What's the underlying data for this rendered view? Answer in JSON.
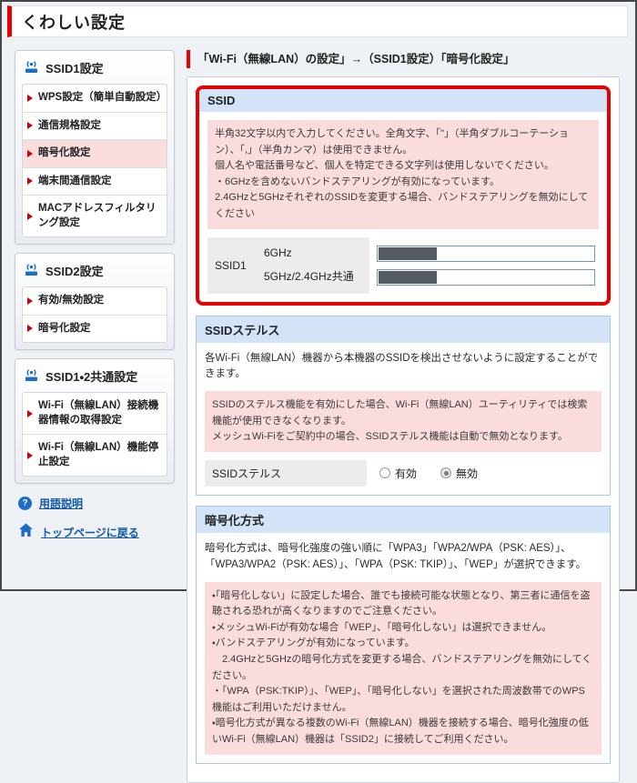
{
  "page": {
    "title": "くわしい設定"
  },
  "colors": {
    "accent_red": "#e60000",
    "section_header_blue": "#d3e4f8",
    "notice_pink": "#fadcdc",
    "link_blue": "#1257a4",
    "icon_blue": "#1b6ec8",
    "active_item_pink": "#fadddd",
    "masked_value_gray": "#565b61"
  },
  "icons": {
    "question_glyph": "?"
  },
  "sidebar": {
    "sections": [
      {
        "title": "SSID1設定",
        "icon": "router-signal-icon",
        "items": [
          {
            "label": "WPS設定（簡単自動設定）",
            "active": false
          },
          {
            "label": "通信規格設定",
            "active": false
          },
          {
            "label": "暗号化設定",
            "active": true
          },
          {
            "label": "端末間通信設定",
            "active": false
          },
          {
            "label": "MACアドレスフィルタリング設定",
            "active": false
          }
        ]
      },
      {
        "title": "SSID2設定",
        "icon": "router-signal-icon",
        "items": [
          {
            "label": "有効/無効設定",
            "active": false
          },
          {
            "label": "暗号化設定",
            "active": false
          }
        ]
      },
      {
        "title": "SSID1・2共通設定",
        "icon": "router-signal-icon",
        "items": [
          {
            "label": "Wi-Fi（無線LAN）接続機器情報の取得設定",
            "active": false
          },
          {
            "label": "Wi-Fi（無線LAN）機能停止設定",
            "active": false
          }
        ]
      }
    ],
    "links": [
      {
        "label": "用語説明",
        "icon": "question-icon"
      },
      {
        "label": "トップページに戻る",
        "icon": "home-icon"
      }
    ]
  },
  "main": {
    "breadcrumb": "「Wi-Fi（無線LAN）の設定」→（SSID1設定）「暗号化設定」",
    "ssid_section": {
      "title": "SSID",
      "highlighted": true,
      "notice_lines": [
        "半角32文字以内で入力してください。全角文字、「\"」（半角ダブルコーテーション）、「,」（半角カンマ）は使用できません。",
        "個人名や電話番号など、個人を特定できる文字列は使用しないでください。",
        "・6GHzを含めないバンドステアリングが有効になっています。",
        "2.4GHzと5GHzそれぞれのSSIDを変更する場合、バンドステアリングを無効にしてください"
      ],
      "row_label": "SSID1",
      "fields": [
        {
          "label": "6GHz",
          "value": "",
          "value_masked": true
        },
        {
          "label": "5GHz/2.4GHz共通",
          "value": "",
          "value_masked": true
        }
      ]
    },
    "stealth_section": {
      "title": "SSIDステルス",
      "description": "各Wi-Fi（無線LAN）機器から本機器のSSIDを検出させないように設定することができます。",
      "notice_lines": [
        "SSIDのステルス機能を有効にした場合、Wi-Fi（無線LAN）ユーティリティでは検索機能が使用できなくなります。",
        "メッシュWi-Fiをご契約中の場合、SSIDステルス機能は自動で無効となります。"
      ],
      "field_label": "SSIDステルス",
      "radio_options": [
        {
          "label": "有効",
          "selected": false
        },
        {
          "label": "無効",
          "selected": true
        }
      ]
    },
    "encryption_section": {
      "title": "暗号化方式",
      "description": "暗号化方式は、暗号化強度の強い順に「WPA3」「WPA2/WPA（PSK: AES）」、「WPA3/WPA2（PSK: AES）」、「WPA（PSK: TKIP）」、「WEP」が選択できます。",
      "notice_lines": [
        "・「暗号化しない」に設定した場合、誰でも接続可能な状態となり、第三者に通信を盗聴される恐れが高くなりますのでご注意ください。",
        "・メッシュWi-Fiが有効な場合「WEP」、「暗号化しない」は選択できません。",
        "・バンドステアリングが有効になっています。",
        "　2.4GHzと5GHzの暗号化方式を変更する場合、バンドステアリングを無効にしてください。",
        "・「WPA（PSK:TKIP）」、「WEP」、「暗号化しない」を選択された周波数帯でのWPS機能はご利用いただけません。",
        "・暗号化方式が異なる複数のWi-Fi（無線LAN）機器を接続する場合、暗号化強度の低いWi-Fi（無線LAN）機器は「SSID2」に接続してご利用ください。"
      ]
    }
  }
}
